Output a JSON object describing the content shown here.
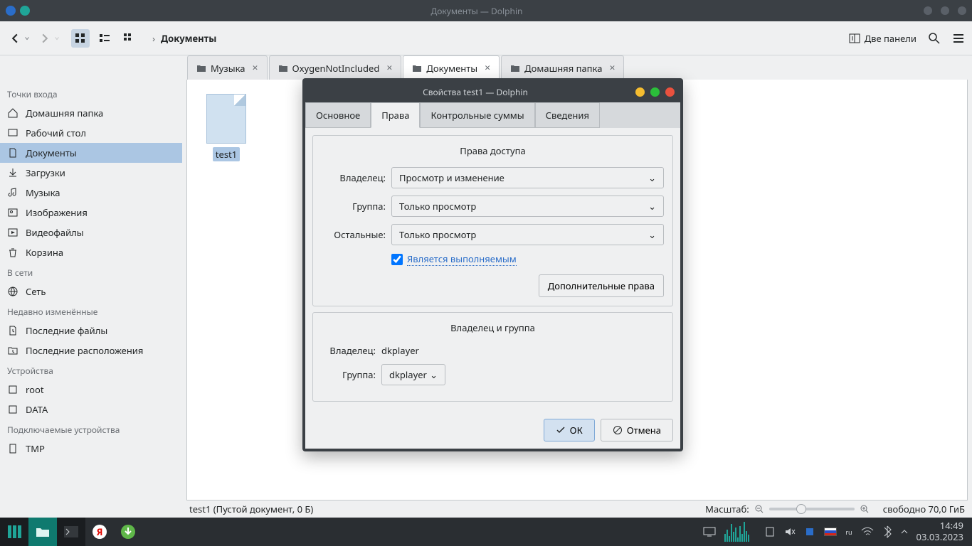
{
  "window": {
    "title": "Документы — Dolphin"
  },
  "toolbar": {
    "breadcrumb": "Документы",
    "two_panels": "Две панели"
  },
  "tabs": [
    {
      "label": "Музыка"
    },
    {
      "label": "OxygenNotIncluded"
    },
    {
      "label": "Документы"
    },
    {
      "label": "Домашняя папка"
    }
  ],
  "sidebar": {
    "places_head": "Точки входа",
    "places": [
      "Домашняя папка",
      "Рабочий стол",
      "Документы",
      "Загрузки",
      "Музыка",
      "Изображения",
      "Видеофайлы",
      "Корзина"
    ],
    "network_head": "В сети",
    "network": [
      "Сеть"
    ],
    "recent_head": "Недавно изменённые",
    "recent": [
      "Последние файлы",
      "Последние расположения"
    ],
    "devices_head": "Устройства",
    "devices": [
      "root",
      "DATA"
    ],
    "removable_head": "Подключаемые устройства",
    "removable": [
      "TMP"
    ]
  },
  "file": {
    "name": "test1"
  },
  "status": {
    "left": "test1 (Пустой документ, 0 Б)",
    "scale_label": "Масштаб:",
    "free": "свободно 70,0 ГиБ"
  },
  "dialog": {
    "title": "Свойства test1 — Dolphin",
    "tabs": {
      "general": "Основное",
      "perms": "Права",
      "checksums": "Контрольные суммы",
      "details": "Сведения"
    },
    "perms_title": "Права доступа",
    "owner_label": "Владелец:",
    "group_label": "Группа:",
    "others_label": "Остальные:",
    "owner_value": "Просмотр и изменение",
    "group_value": "Только просмотр",
    "others_value": "Только просмотр",
    "exec_label": "Является выполняемым",
    "advanced": "Дополнительные права",
    "og_title": "Владелец и группа",
    "og_owner_label": "Владелец:",
    "og_owner_value": "dkplayer",
    "og_group_label": "Группа:",
    "og_group_value": "dkplayer",
    "ok": "ОК",
    "cancel": "Отмена"
  },
  "taskbar": {
    "lang": "ru",
    "time": "14:49",
    "date": "03.03.2023"
  }
}
